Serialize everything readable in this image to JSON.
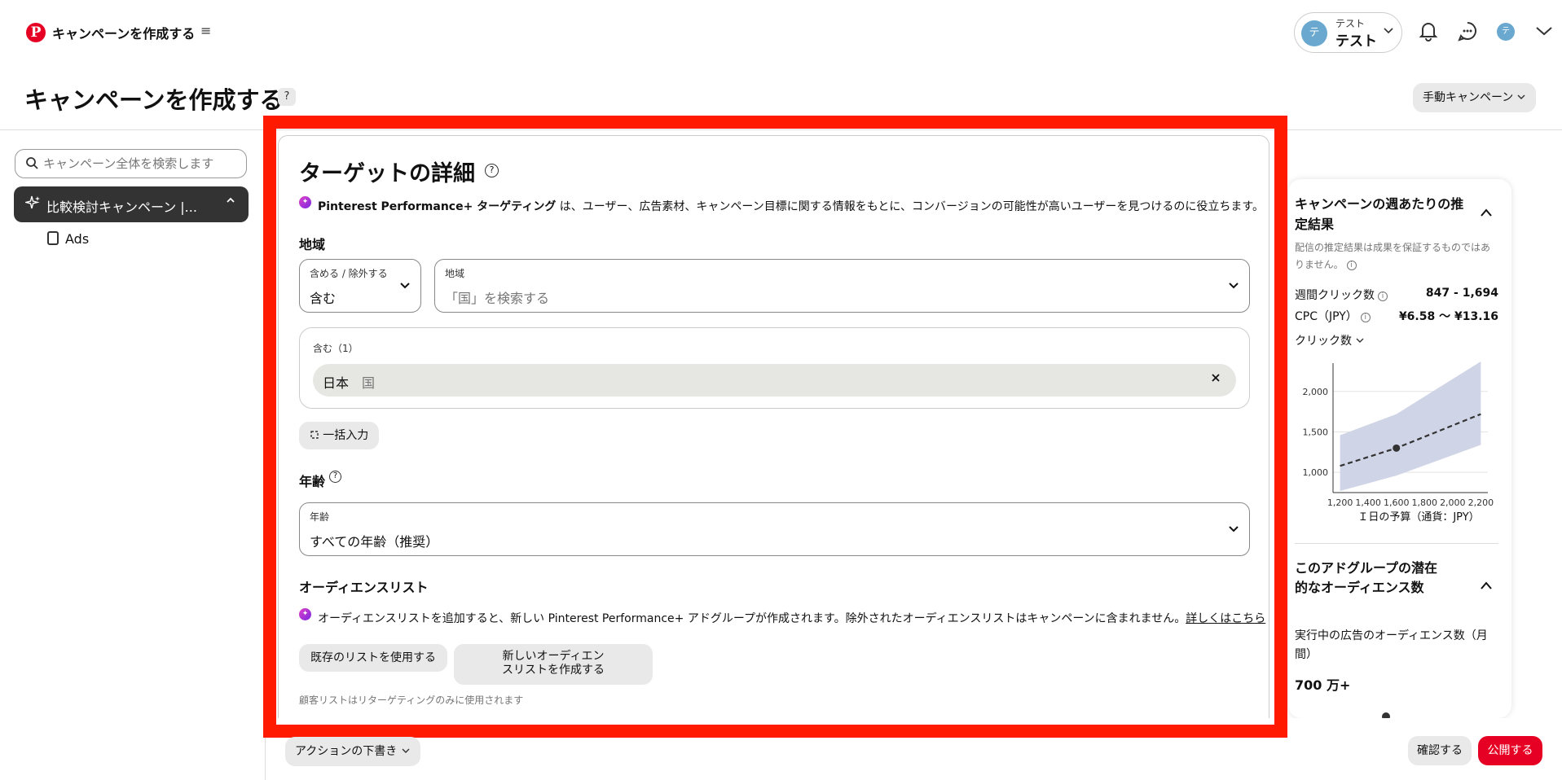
{
  "header": {
    "logo": "P",
    "app_title": "キャンペーンを作成する",
    "menu_glyph": "≡",
    "account": {
      "avatar": "テ",
      "label": "テスト",
      "name": "テスト"
    },
    "user_avatar": "テ"
  },
  "page": {
    "title": "キャンペーンを作成する",
    "help_glyph": "?",
    "campaign_mode": "手動キャンペーン"
  },
  "sidebar": {
    "search_placeholder": "キャンペーン全体を検索します",
    "campaign_label": "比較検討キャンペーン |...",
    "ads_label": "Ads"
  },
  "targeting": {
    "title": "ターゲットの詳細",
    "pp_brand": "Pinterest Performance+ ターゲティング",
    "pp_text": " は、ユーザー、広告素材、キャンペーン目標に関する情報をもとに、コンバージョンの可能性が高いユーザーを見つけるのに役立ちます。",
    "region_label": "地域",
    "include_field_label": "含める / 除外する",
    "include_value": "含む",
    "region_field_label": "地域",
    "region_placeholder": "「国」を検索する",
    "included_label": "含む（1）",
    "chip_name": "日本",
    "chip_type": "国",
    "bulk_button": "一括入力",
    "age_label": "年齢",
    "age_field_label": "年齢",
    "age_value": "すべての年齢（推奨）",
    "audience_label": "オーディエンスリスト",
    "audience_text": "オーディエンスリストを追加すると、新しい Pinterest Performance+ アドグループが作成されます。除外されたオーディエンスリストはキャンペーンに含まれません。",
    "audience_link": "詳しくはこちら",
    "use_existing_button": "既存のリストを使用する",
    "new_list_button_line1": "新しいオーディエン",
    "new_list_button_line2": "スリストを作成する",
    "note": "顧客リストはリターゲティングのみに使用されます"
  },
  "estimates": {
    "title": "キャンペーンの週あたりの推定結果",
    "note": "配信の推定結果は成果を保証するものではありません。",
    "weekly_clicks_label": "週間クリック数",
    "weekly_clicks_value": "847 - 1,694",
    "cpc_label": "CPC（JPY）",
    "cpc_value": "¥6.58 〜 ¥13.16",
    "metric_selector": "クリック数",
    "audience_title": "このアドグループの潜在的なオーディエンス数",
    "audience_label": "実行中の広告のオーディエンス数（月間）",
    "audience_value": "700 万+"
  },
  "chart_data": {
    "type": "line",
    "xlabel": "Ｉ日の予算（通貨：JPY）",
    "ylabel": "",
    "x_ticks": [
      "1,200",
      "1,400",
      "1,600",
      "1,800",
      "2,000",
      "2,200"
    ],
    "y_ticks": [
      "1,000",
      "1,500",
      "2,000"
    ],
    "xlim": [
      1150,
      2250
    ],
    "ylim": [
      750,
      2350
    ],
    "series": [
      {
        "values_x": [
          1200,
          1600,
          2200
        ],
        "values_y": [
          1080,
          1300,
          1720
        ]
      }
    ],
    "band_upper": {
      "x": [
        1200,
        1600,
        2200
      ],
      "y": [
        1460,
        1720,
        2370
      ]
    },
    "band_lower": {
      "x": [
        1200,
        1600,
        2200
      ],
      "y": [
        770,
        960,
        1340
      ]
    },
    "marker": {
      "x": 1600,
      "y": 1300
    },
    "band_color": "#cfd4e6",
    "line_color": "#333333"
  },
  "footer": {
    "draft_button": "アクションの下書き",
    "confirm_button": "確認する",
    "publish_button": "公開する"
  },
  "colors": {
    "accent": "#e60023",
    "highlight_frame": "#ff1a00"
  }
}
